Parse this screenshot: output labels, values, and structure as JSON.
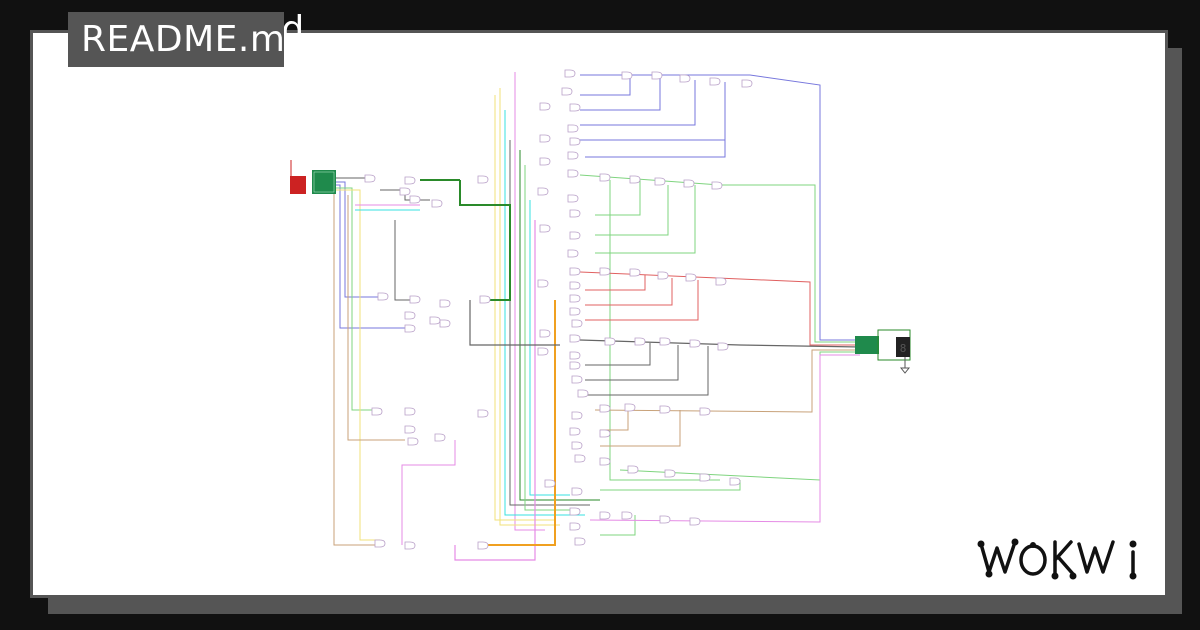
{
  "tab": {
    "title": "README.md"
  },
  "logo": {
    "text": "WOKWI"
  },
  "colors": {
    "background": "#111111",
    "card": "#ffffff",
    "frame": "#555555",
    "wire_green": "#2a8a2a",
    "wire_light_green": "#7fd47f",
    "wire_pink": "#e58be5",
    "wire_yellow": "#f2e27a",
    "wire_cyan": "#37e0e0",
    "wire_orange": "#f0a020",
    "wire_blue": "#7777dd",
    "wire_red": "#e06060",
    "wire_gray": "#666666",
    "wire_tan": "#c8a27a",
    "component_green": "#1f8a4c",
    "component_red": "#cc2222"
  },
  "circuit": {
    "label": "",
    "components": [
      "dip-switch",
      "input-header",
      "logic-gates",
      "output-header",
      "seven-segment-display"
    ]
  }
}
